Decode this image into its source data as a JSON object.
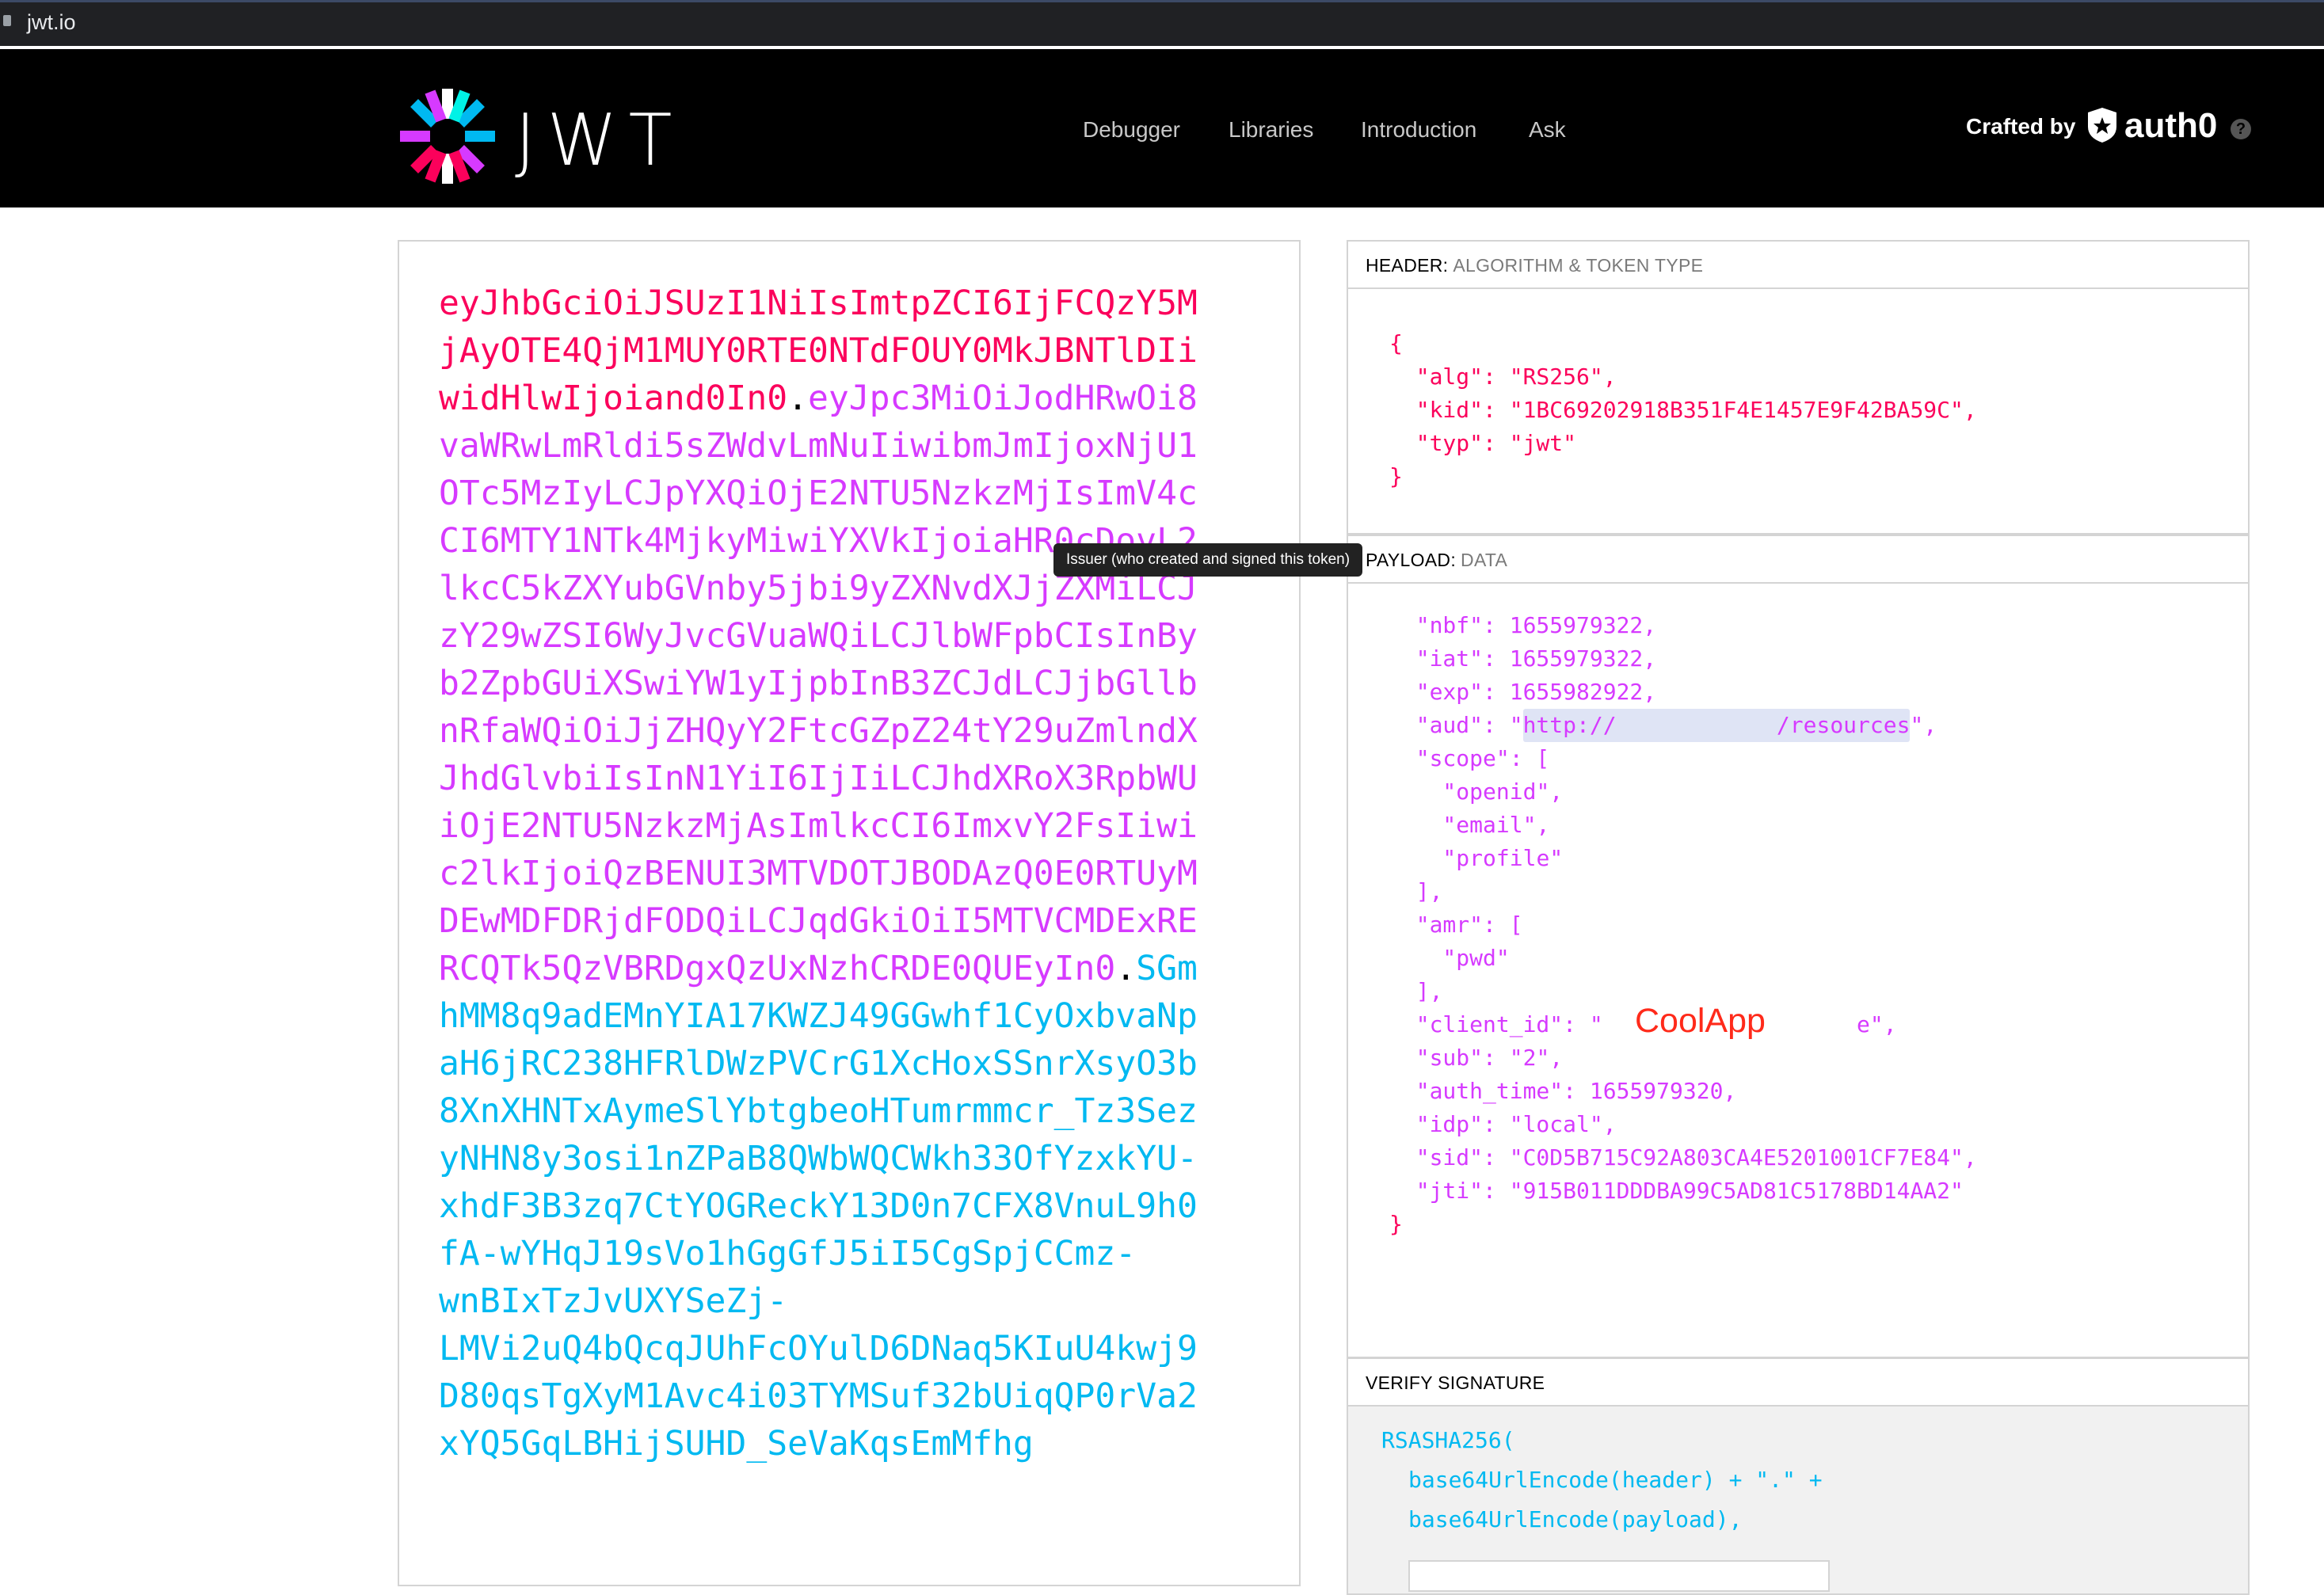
{
  "browser": {
    "url": "jwt.io"
  },
  "nav": {
    "logo_text": "JWT",
    "links": [
      "Debugger",
      "Libraries",
      "Introduction",
      "Ask"
    ],
    "crafted_by": "Crafted by",
    "brand": "auth0",
    "help": "?"
  },
  "encoded": {
    "header": "eyJhbGciOiJSUzI1NiIsImtpZCI6IjFCQzY5MjAyOTE4QjM1MUY0RTE0NTdFOUY0MkJBNTlDIiwidHlwIjoiand0In0",
    "payload": "eyJpc3MiOiJodHRwOi8vaWRwLmRldi5sZWdvLmNuIiwibmJmIjoxNjU1OTc5MzIyLCJpYXQiOjE2NTU5NzkzMjIsImV4cCI6MTY1NTk4MjkyMiwiYXVkIjoiaHR0cDovL2lkcC5kZXYubGVnby5jbi9yZXNvdXJjZXMiLCJzY29wZSI6WyJvcGVuaWQiLCJlbWFpbCIsInByb2ZpbGUiXSwiYW1yIjpbInB3ZCJdLCJjbGllbnRfaWQiOiJjZHQyY2FtcGZpZ24tY29uZmlndXJhdGlvbiIsInN1YiI6IjIiLCJhdXRoX3RpbWUiOjE2NTU5NzkzMjAsImlkcCI6ImxvY2FsIiwic2lkIjoiQzBENUI3MTVDOTJBODAzQ0E0RTUyMDEwMDFDRjdFODQiLCJqdGkiOiI5MTVCMDExRERCQTk5QzVBRDgxQzUxNzhCRDE0QUEyIn0",
    "signature": "SGmhMM8q9adEMnYIA17KWZJ49GGwhf1CyOxbvaNpaH6jRC238HFRlDWzPVCrG1XcHoxSSnrXsyO3b8XnXHNTxAymeSlYbtgbeoHTumrmmcr_Tz3SezyNHN8y3osi1nZPaB8QWbWQCWkh33OfYzxkYU-\nxhdF3B3zq7CtYOGReckY13D0n7CFX8VnuL9h0fA-wYHqJ19sVo1hGgGfJ5iI5CgSpjCCmz-\nwnBIxTzJvUXYSeZj-\nLMVi2uQ4bQcqJUhFcOYulD6DNaq5KIuU4kwj9D80qsTgXyM1Avc4i03TYMSuf32bUiqQP0rVa2xYQ5GqLBHijSUHD_SeVaKqsEmMfhg"
  },
  "tooltip": "Issuer (who created and signed this token)",
  "header_panel": {
    "title": "HEADER:",
    "subtitle": "ALGORITHM & TOKEN TYPE",
    "alg": "RS256",
    "kid": "1BC69202918B351F4E1457E9F42BA59C",
    "typ": "jwt"
  },
  "payload_panel": {
    "title": "PAYLOAD:",
    "subtitle": "DATA",
    "nbf": "1655979322",
    "iat": "1655979322",
    "exp": "1655982922",
    "aud_prefix": "http://",
    "aud_suffix": "/resources",
    "scope": [
      "openid",
      "email",
      "profile"
    ],
    "amr": [
      "pwd"
    ],
    "client_id_visible": "CoolApp",
    "sub": "2",
    "auth_time": "1655979320",
    "idp": "local",
    "sid": "C0D5B715C92A803CA4E5201001CF7E84",
    "jti": "915B011DDDBA99C5AD81C5178BD14AA2"
  },
  "verify_panel": {
    "title": "VERIFY SIGNATURE",
    "line1": "RSASHA256(",
    "line2": "base64UrlEncode(header) + \".\" +",
    "line3": "base64UrlEncode(payload),"
  },
  "colors": {
    "header": "#fb015b",
    "payload": "#d63aff",
    "signature": "#00b9f1"
  }
}
